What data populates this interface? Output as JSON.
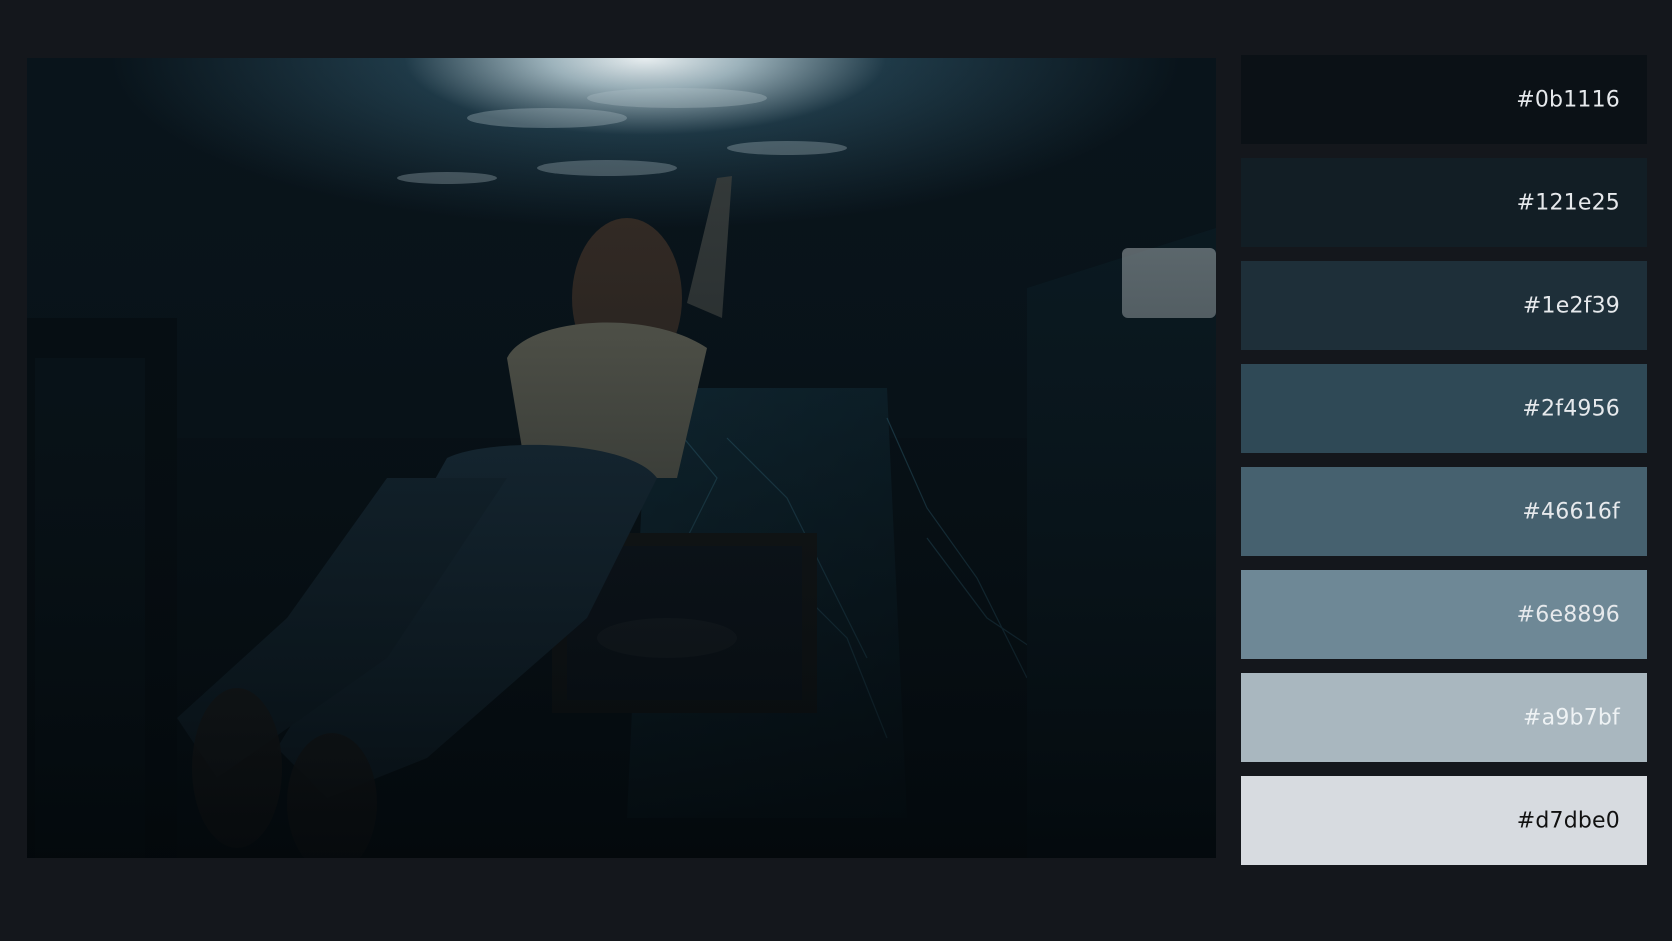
{
  "photo": {
    "subject": "person-reaching-up-underwater-icon"
  },
  "palette": {
    "swatches": [
      {
        "hex": "#0b1116",
        "color": "#0b1116",
        "text_color": "#e6e9ec"
      },
      {
        "hex": "#121e25",
        "color": "#121e25",
        "text_color": "#e6e9ec"
      },
      {
        "hex": "#1e2f39",
        "color": "#1e2f39",
        "text_color": "#e6e9ec"
      },
      {
        "hex": "#2f4956",
        "color": "#2f4956",
        "text_color": "#e6e9ec"
      },
      {
        "hex": "#46616f",
        "color": "#46616f",
        "text_color": "#e6e9ec"
      },
      {
        "hex": "#6e8896",
        "color": "#6e8896",
        "text_color": "#e6e9ec"
      },
      {
        "hex": "#a9b7bf",
        "color": "#a9b7bf",
        "text_color": "#eef2f4"
      },
      {
        "hex": "#d7dbe0",
        "color": "#d7dbe0",
        "text_color": "#111111"
      }
    ]
  }
}
